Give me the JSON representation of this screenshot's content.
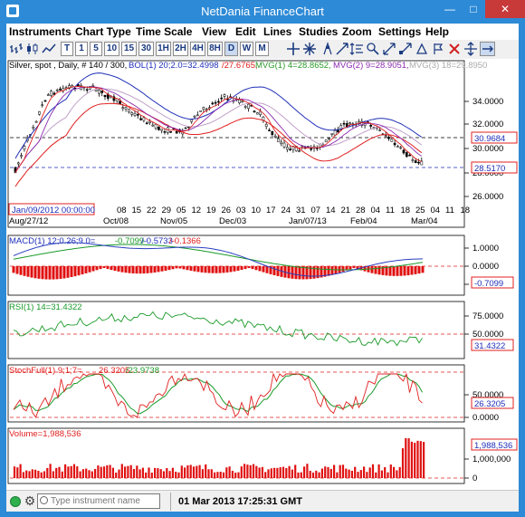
{
  "window": {
    "title": "NetDania FinanceChart",
    "minimize": "—",
    "maximize": "□",
    "close": "✕"
  },
  "menu": [
    "Instruments",
    "Chart Type",
    "Time Scale",
    "View",
    "Edit",
    "Lines",
    "Studies",
    "Zoom",
    "Settings",
    "Help"
  ],
  "toolbar": {
    "timescales": [
      "T",
      "1",
      "5",
      "10",
      "15",
      "30",
      "1H",
      "2H",
      "4H",
      "8H",
      "D",
      "W",
      "M"
    ],
    "active": "D",
    "icons": [
      "bar-chart-icon",
      "candle-chart-icon",
      "line-chart-icon",
      "crosshair-icon",
      "studies-icon",
      "pin-icon",
      "diagonal-arrows-icon",
      "scale-arrows-icon",
      "zoom-icon",
      "settings-icon",
      "mark-icon",
      "remove-icon",
      "move-icon",
      "link-icon"
    ]
  },
  "price_panel": {
    "header": "Silver, spot , Daily, # 140 / 300,",
    "bol_label": "BOL(1) 20;2.0=32.4998",
    "bol_lower": "/27.6765,",
    "mvg1": "MVG(1) 4=28.8652,",
    "mvg2": "MVG(2) 9=28.9051,",
    "mvg3": "MVG(3) 18=29.8950",
    "y_ticks": [
      "34.0000",
      "32.0000",
      "30.0000",
      "28.0000",
      "26.0000"
    ],
    "marker_high": "30.9684",
    "marker_last": "28.5170",
    "cursor_date": "Jan/09/2012 00:00:00",
    "day_ticks": [
      "08",
      "15",
      "22",
      "29",
      "05",
      "12",
      "19",
      "26",
      "03",
      "10",
      "17",
      "24",
      "31",
      "07",
      "14",
      "21",
      "28",
      "04",
      "11",
      "18",
      "25",
      "04",
      "11",
      "18"
    ],
    "month_ticks": [
      "Aug/27/12",
      "Oct/08",
      "Nov/05",
      "Dec/03",
      "Jan/07/13",
      "Feb/04",
      "Mar/04"
    ]
  },
  "macd_panel": {
    "label_name": "MACD(1) 12;0.26;9.0=",
    "label_val1": "-0.7099",
    "label_val2": "/-0.5733",
    "label_val3": "/-0.1366",
    "y_ticks": [
      "1.0000",
      "0.0000",
      "-1.0000"
    ],
    "marker": "-0.7099"
  },
  "rsi_panel": {
    "label": "RSI(1) 14=31.4322",
    "y_ticks": [
      "75.0000",
      "50.0000"
    ],
    "marker": "31.4322"
  },
  "stoch_panel": {
    "label_name": "StochFull(1) 9;1;7=",
    "label_val1": "26.3205",
    "label_val2": "/23.9738",
    "y_ticks": [
      "50.0000",
      "0.0000"
    ],
    "marker": "26.3205"
  },
  "volume_panel": {
    "label": "Volume=1,988,536",
    "y_ticks": [
      "1,000,000",
      "0"
    ],
    "marker": "1,988,536"
  },
  "status": {
    "placeholder": "Type instrument name",
    "datetime": "01 Mar 2013 17:25:31 GMT"
  },
  "colors": {
    "price": "#000000",
    "bollinger": "#1f2fb8",
    "mvg1": "#e02020",
    "mvg2": "#8c2bb0",
    "mvg3": "#c0a0c8",
    "macd": "#2a3fbe",
    "signal": "#1a9a2a",
    "histogram": "#e01010",
    "rsi": "#1a9a2a",
    "stoch_k": "#e02020",
    "stoch_d": "#1a9a2a",
    "volume": "#e01010",
    "frame": "#2d8ad6"
  }
}
